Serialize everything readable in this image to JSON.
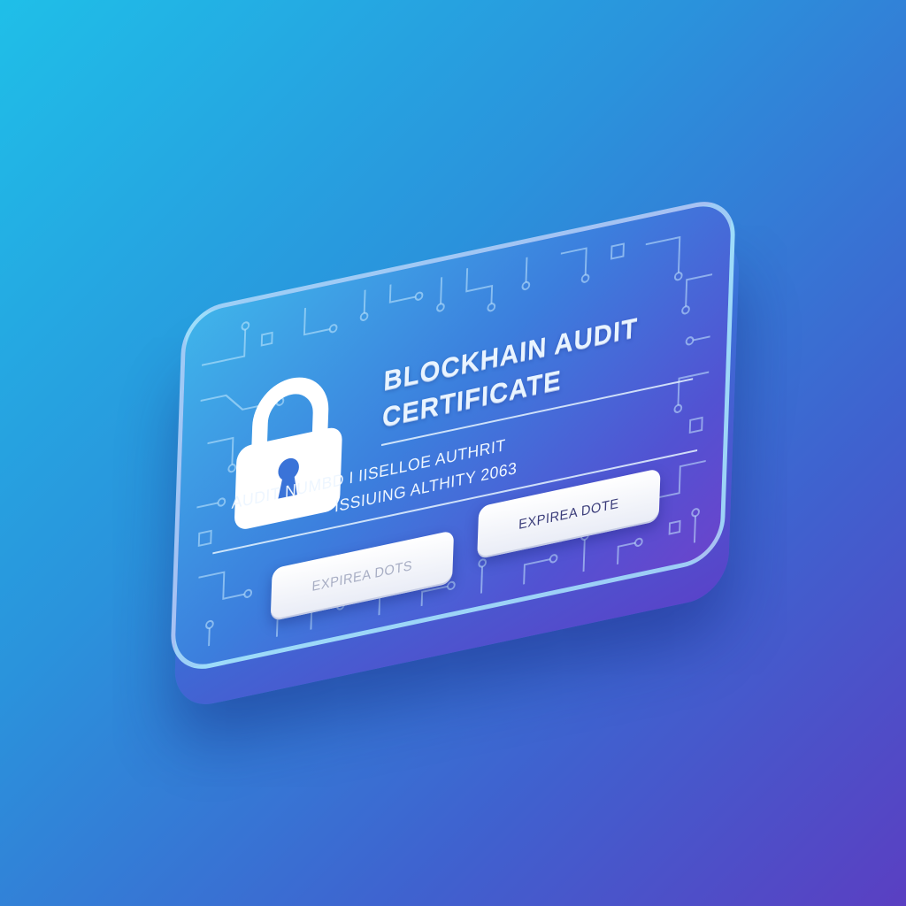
{
  "certificate": {
    "title_line_1": "BLOCKHAIN AUDIT",
    "title_line_2": "CERTIFICATE",
    "meta_line_1": "AUDIT NUMBD I IISELLOE AUTHRIT",
    "meta_line_2": "ISSIUING ALTHITY 2063",
    "field_left_label": "EXPIREA DOTS",
    "field_right_label": "EXPIREA DOTE"
  },
  "icons": {
    "lock": "padlock-icon",
    "pattern": "circuit-board-pattern"
  },
  "colors": {
    "background_start": "#1fbfe8",
    "background_end": "#5a3fc2",
    "card_accent": "#3c7edd",
    "text": "#e9f4ff"
  }
}
